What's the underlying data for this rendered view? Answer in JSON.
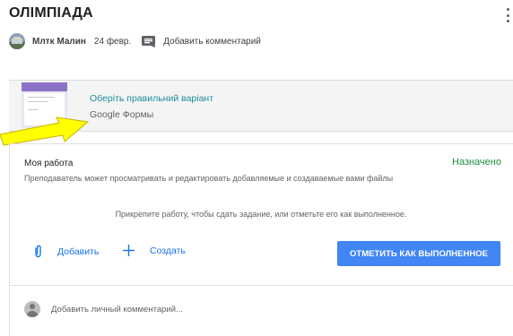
{
  "header": {
    "title": "ОЛІМПІАДА",
    "author": "Млтк Малин",
    "date": "24 февр.",
    "add_comment_label": "Добавить комментарий"
  },
  "attachment": {
    "title": "Оберіть правильний варіант",
    "subtitle": "Google Формы"
  },
  "my_work": {
    "heading": "Моя работа",
    "status": "Назначено",
    "hint": "Преподаватель может просматривать и редактировать добавляемые и создаваемые вами файлы",
    "center_hint": "Прикрепите работу, чтобы сдать задание, или отметьте его как выполненное.",
    "add_label": "Добавить",
    "create_label": "Создать",
    "submit_label": "ОТМЕТИТЬ КАК ВЫПОЛНЕННОЕ"
  },
  "private_comment": {
    "placeholder": "Добавить личный комментарий..."
  },
  "colors": {
    "link": "#1e8e9e",
    "status_green": "#1e8e3e",
    "primary_blue": "#4285f4",
    "action_blue": "#1a73e8",
    "arrow_yellow": "#ffff00"
  },
  "icons": [
    "more-vert-icon",
    "comment-icon",
    "paperclip-icon",
    "plus-icon",
    "user-avatar-icon",
    "annotation-arrow-icon"
  ]
}
